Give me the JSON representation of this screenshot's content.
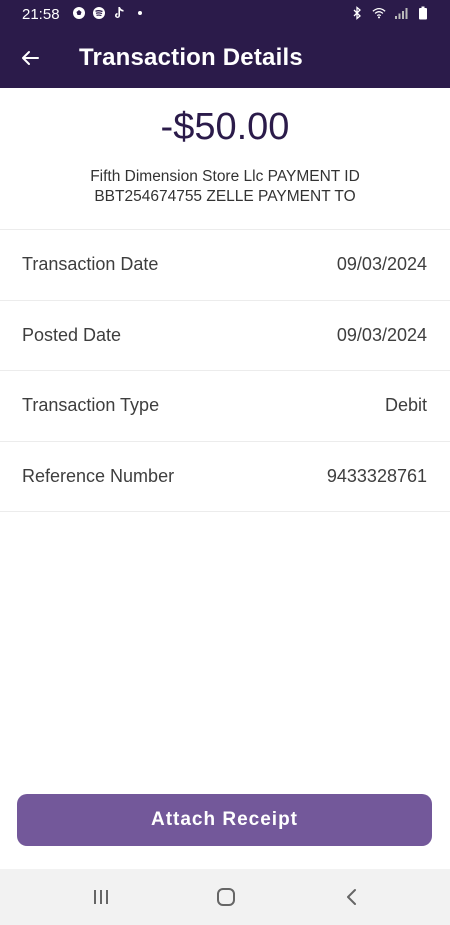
{
  "status_bar": {
    "time": "21:58",
    "left_icons": [
      "soccer-ball-icon",
      "spotify-icon",
      "tiktok-icon",
      "notification-dot-icon"
    ],
    "right_icons": [
      "bluetooth-icon",
      "wifi-icon",
      "signal-icon",
      "battery-icon"
    ]
  },
  "app_bar": {
    "title": "Transaction Details",
    "back_icon": "back-arrow-icon"
  },
  "transaction": {
    "amount": "-$50.00",
    "description": "Fifth Dimension Store Llc PAYMENT ID BBT254674755 ZELLE PAYMENT TO"
  },
  "details": [
    {
      "label": "Transaction Date",
      "value": "09/03/2024"
    },
    {
      "label": "Posted Date",
      "value": "09/03/2024"
    },
    {
      "label": "Transaction Type",
      "value": "Debit"
    },
    {
      "label": "Reference Number",
      "value": "9433328761"
    }
  ],
  "actions": {
    "attach_receipt_label": "Attach Receipt"
  },
  "nav_bar": {
    "buttons": [
      "recent-apps-icon",
      "home-icon",
      "back-icon"
    ]
  },
  "colors": {
    "header_bg": "#2b1b4a",
    "amount_text": "#2b1b4a",
    "button_bg": "#73589a",
    "nav_bg": "#f2f2f2"
  }
}
